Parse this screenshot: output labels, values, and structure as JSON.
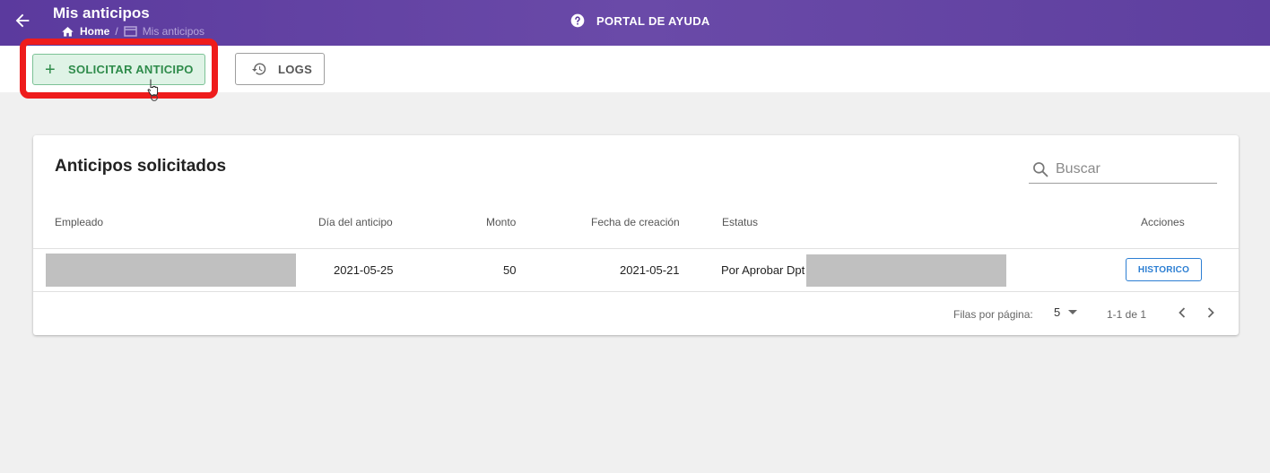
{
  "header": {
    "title": "Mis anticipos",
    "breadcrumb": {
      "home": "Home",
      "separator": "/",
      "current": "Mis anticipos"
    },
    "help_label": "PORTAL DE AYUDA"
  },
  "toolbar": {
    "request_label": "SOLICITAR ANTICIPO",
    "request_icon": "+",
    "logs_label": "LOGS"
  },
  "card": {
    "title": "Anticipos solicitados",
    "search_placeholder": "Buscar",
    "columns": {
      "empleado": "Empleado",
      "dia": "Día del anticipo",
      "monto": "Monto",
      "fecha": "Fecha de creación",
      "estatus": "Estatus",
      "acciones": "Acciones"
    },
    "rows": [
      {
        "empleado": "",
        "dia": "2021-05-25",
        "monto": "50",
        "fecha": "2021-05-21",
        "estatus": "Por Aprobar Dpt",
        "action_label": "HISTORICO"
      }
    ],
    "pagination": {
      "rows_per_page_label": "Filas por página:",
      "rows_per_page": "5",
      "range": "1-1 de 1"
    }
  },
  "colors": {
    "header_bg": "#5b3a9e",
    "request_bg": "#dff3e6",
    "request_text": "#2e8b4a",
    "highlight": "#ee1c1c",
    "link_blue": "#2d7fd3",
    "page_bg": "#f0f0f0"
  },
  "icons": [
    "arrow-left-icon",
    "home-icon",
    "page-icon",
    "help-circle-icon",
    "plus-icon",
    "history-icon",
    "search-icon",
    "caret-down-icon",
    "chevron-left-icon",
    "chevron-right-icon",
    "mouse-pointer-icon"
  ]
}
